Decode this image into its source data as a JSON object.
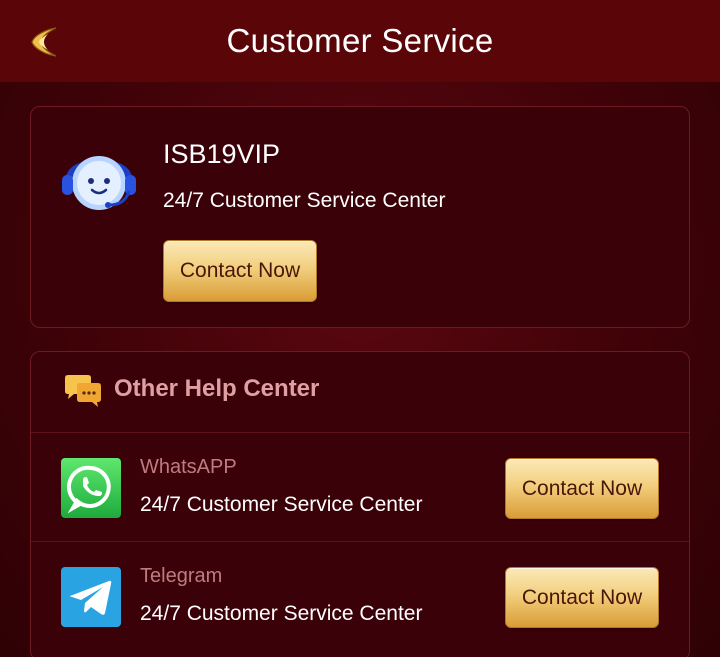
{
  "header": {
    "title": "Customer Service",
    "back_icon": "back-arrow-icon"
  },
  "vip": {
    "name": "ISB19VIP",
    "subtitle": "24/7 Customer Service Center",
    "button_label": "Contact Now",
    "avatar_icon": "support-headset-avatar-icon"
  },
  "help_center": {
    "title": "Other Help Center",
    "icon": "chat-bubbles-icon",
    "items": [
      {
        "name": "WhatsAPP",
        "subtitle": "24/7 Customer Service Center",
        "button_label": "Contact Now",
        "icon": "whatsapp-icon"
      },
      {
        "name": "Telegram",
        "subtitle": "24/7 Customer Service Center",
        "button_label": "Contact Now",
        "icon": "telegram-icon"
      }
    ]
  },
  "colors": {
    "header_bg": "#5a0608",
    "card_bg": "#3a0208",
    "gold_button": "#f2cf7e",
    "muted_label": "#c07b80",
    "whatsapp": "#25d366",
    "telegram": "#2aa3e2"
  }
}
